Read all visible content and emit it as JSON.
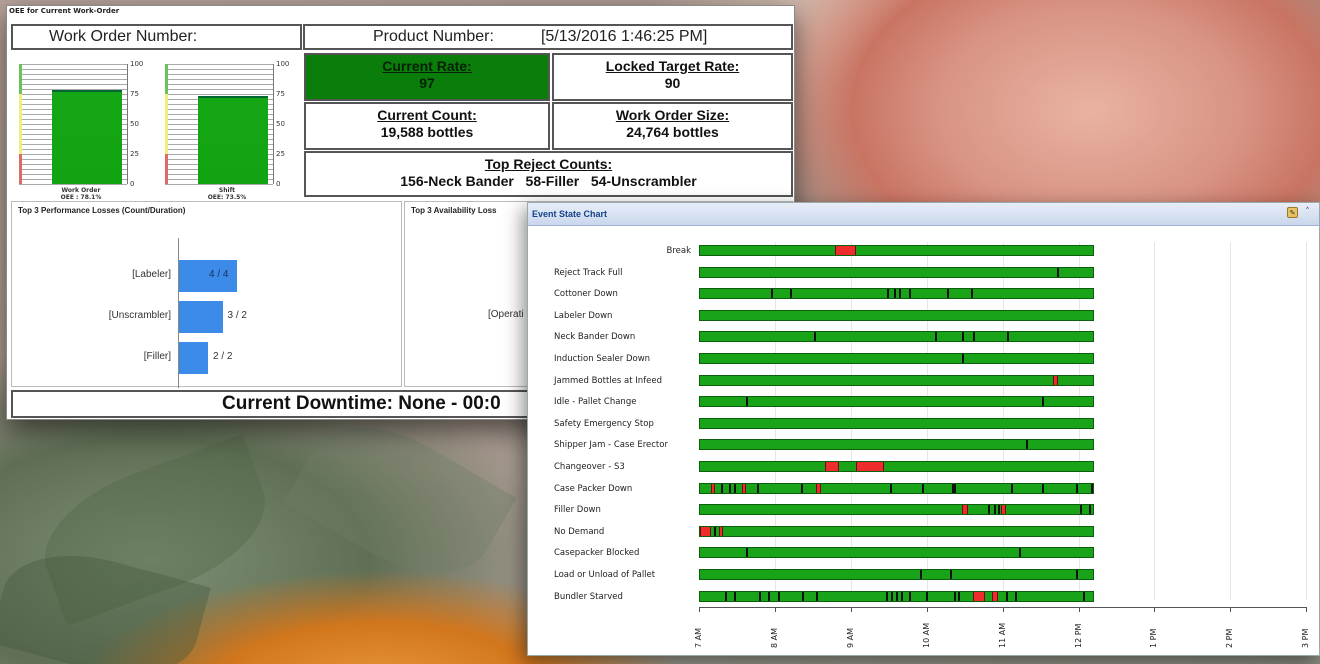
{
  "oee": {
    "title": "OEE for Current Work-Order",
    "work_order_label": "Work Order Number:",
    "product_label": "Product Number:",
    "timestamp": "[5/13/2016 1:46:25 PM]",
    "gauges": [
      {
        "name": "Work Order",
        "oee_label": "OEE : 78.1%",
        "value": 78.1
      },
      {
        "name": "Shift",
        "oee_label": "OEE: 73.5%",
        "value": 73.5
      }
    ],
    "gauge_scale": [
      "100",
      "75",
      "50",
      "25",
      "0"
    ],
    "zone_colors": {
      "green": "#6cc25a",
      "yellow": "#f0ef7a",
      "red": "#e06a6a"
    },
    "current_rate": {
      "title": "Current Rate:",
      "value": "97"
    },
    "locked_target": {
      "title": "Locked Target Rate:",
      "value": "90"
    },
    "current_count": {
      "title": "Current Count:",
      "value": "19,588 bottles"
    },
    "work_order_size": {
      "title": "Work Order Size:",
      "value": "24,764 bottles"
    },
    "top_reject": {
      "title": "Top Reject Counts:",
      "value": "156-Neck Bander   58-Filler   54-Unscrambler"
    },
    "perf_losses": {
      "title": "Top 3 Performance Losses (Count/Duration)",
      "items": [
        {
          "category": "[Labeler]",
          "label": "4 / 4",
          "count": 4
        },
        {
          "category": "[Unscrambler]",
          "label": "3 / 2",
          "count": 3
        },
        {
          "category": "[Filler]",
          "label": "2 / 2",
          "count": 2
        }
      ]
    },
    "avail_losses": {
      "title": "Top 3 Availability Loss",
      "partial_category": "[Operati"
    },
    "downtime": "Current Downtime: None - 00:0"
  },
  "event_chart": {
    "title": "Event State Chart",
    "icons": [
      "pin-icon",
      "collapse-icon"
    ],
    "colors": {
      "running": "#19a319",
      "down": "#ef2c2c",
      "short_stop": "#111111"
    },
    "x_ticks": [
      "7 AM",
      "8 AM",
      "9 AM",
      "10 AM",
      "11 AM",
      "12 PM",
      "1 PM",
      "2 PM",
      "3 PM"
    ],
    "time_range_hours": [
      7,
      15
    ],
    "data_end_hour": 12.2,
    "rows": [
      {
        "label": "Break",
        "align": "right",
        "red": [
          [
            8.78,
            9.05
          ]
        ],
        "black": []
      },
      {
        "label": "Reject Track Full",
        "align": "left",
        "red": [],
        "black": [
          11.7
        ]
      },
      {
        "label": "Cottoner Down",
        "align": "left",
        "red": [],
        "black": [
          7.93,
          8.18,
          9.47,
          9.55,
          9.62,
          9.75,
          10.25,
          10.57
        ]
      },
      {
        "label": "Labeler Down",
        "align": "left",
        "red": [],
        "black": []
      },
      {
        "label": "Neck Bander Down",
        "align": "left",
        "red": [],
        "black": [
          8.5,
          10.1,
          10.45,
          10.6,
          11.05
        ]
      },
      {
        "label": "Induction Sealer Down",
        "align": "left",
        "red": [],
        "black": [
          10.45
        ]
      },
      {
        "label": "Jammed Bottles at Infeed",
        "align": "left",
        "red": [
          [
            11.65,
            11.72
          ]
        ],
        "black": []
      },
      {
        "label": "Idle - Pallet Change",
        "align": "left",
        "red": [],
        "black": [
          7.6,
          11.5
        ]
      },
      {
        "label": "Safety Emergency Stop",
        "align": "left",
        "red": [],
        "black": []
      },
      {
        "label": "Shipper Jam - Case Erector",
        "align": "left",
        "red": [],
        "black": [
          11.3
        ]
      },
      {
        "label": "Changeover - S3",
        "align": "left",
        "red": [
          [
            8.65,
            8.83
          ],
          [
            9.05,
            9.42
          ]
        ],
        "black": []
      },
      {
        "label": "Case Packer Down",
        "align": "left",
        "red": [
          [
            7.15,
            7.2
          ],
          [
            7.55,
            7.6
          ],
          [
            8.53,
            8.6
          ]
        ],
        "black": [
          7.28,
          7.38,
          7.45,
          7.75,
          8.33,
          9.5,
          9.93,
          10.32,
          10.35,
          11.1,
          11.5,
          11.95,
          12.15
        ]
      },
      {
        "label": "Filler Down",
        "align": "left",
        "red": [
          [
            10.45,
            10.53
          ],
          [
            10.97,
            11.03
          ]
        ],
        "black": [
          10.8,
          10.87,
          10.93,
          12.0,
          12.13
        ]
      },
      {
        "label": "No Demand",
        "align": "left",
        "red": [
          [
            7.0,
            7.15
          ],
          [
            7.25,
            7.3
          ]
        ],
        "black": [
          7.18
        ]
      },
      {
        "label": "Casepacker Blocked",
        "align": "left",
        "red": [],
        "black": [
          7.6,
          11.2
        ]
      },
      {
        "label": "Load or Unload of Pallet",
        "align": "left",
        "red": [],
        "black": [
          9.9,
          10.3,
          11.95
        ]
      },
      {
        "label": "Bundler Starved",
        "align": "left",
        "red": [
          [
            10.6,
            10.75
          ],
          [
            10.85,
            10.92
          ]
        ],
        "black": [
          7.33,
          7.45,
          7.78,
          7.9,
          8.03,
          8.35,
          8.53,
          9.45,
          9.52,
          9.58,
          9.65,
          9.75,
          9.98,
          10.35,
          10.4,
          11.03,
          11.15,
          12.05
        ]
      }
    ]
  }
}
